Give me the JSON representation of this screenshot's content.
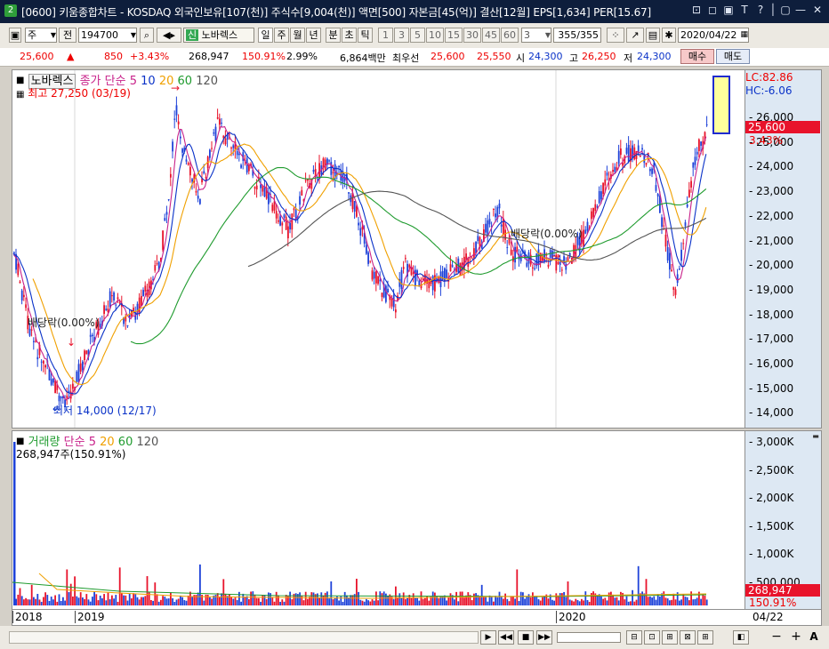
{
  "window": {
    "icon_text": "2",
    "title": "[0600] 키움종합차트 - KOSDAQ 외국인보유[107(천)] 주식수[9,004(천)] 액면[500] 자본금[45(억)] 결산[12월] EPS[1,634] PER[15.67]",
    "controls": [
      "⊡",
      "◻",
      "▣",
      "T",
      "?",
      "│",
      "▢",
      "◫",
      "—",
      "✕"
    ]
  },
  "toolbar": {
    "mode": "주",
    "prev_label": "전",
    "code": "194700",
    "credit_badge": "신",
    "stock_name": "노바렉스",
    "periods": [
      "일",
      "주",
      "월",
      "년",
      "분",
      "초",
      "틱"
    ],
    "selected_period": "일",
    "intervals": [
      "1",
      "3",
      "5",
      "10",
      "15",
      "30",
      "45",
      "60"
    ],
    "interval_value": "3",
    "count": "355/355",
    "date": "2020/04/22"
  },
  "quote": {
    "price": "25,600",
    "change": "850",
    "change_rate": "+3.43%",
    "volume": "268,947",
    "volume_rate": "150.91%",
    "turnover": "2.99%",
    "amount": "6,864백만",
    "ask_label": "최우선",
    "ask": "25,600",
    "bid": "25,550",
    "open_label": "시",
    "open": "24,300",
    "high_label": "고",
    "high": "26,250",
    "low_label": "저",
    "low": "24,300",
    "buy_label": "매수",
    "sell_label": "매도"
  },
  "price_pane": {
    "legend": {
      "name": "노바렉스",
      "price_label": "종가",
      "ma_label": "단순",
      "ma": [
        "5",
        "10",
        "20",
        "60",
        "120"
      ],
      "ma_colors": [
        "#c8228a",
        "#0a32c8",
        "#f0a000",
        "#1f9b2e",
        "#555555"
      ]
    },
    "max_label": "최고 27,250 (03/19)",
    "min_label": "최저 14,000 (12/17)",
    "dividend_label_1": "배당락(0.00%)",
    "dividend_label_2": "배당락(0.00%)",
    "lc": "LC:82.86",
    "hc": "HC:-6.06",
    "current_price": "25,600",
    "current_rate": "3.43%",
    "axis_ticks": [
      "26,000",
      "25,000",
      "24,000",
      "23,000",
      "22,000",
      "21,000",
      "20,000",
      "19,000",
      "18,000",
      "17,000",
      "16,000",
      "15,000",
      "14,000"
    ]
  },
  "volume_pane": {
    "legend": {
      "name": "거래량",
      "ma_label": "단순",
      "ma": [
        "5",
        "20",
        "60",
        "120"
      ]
    },
    "last_label": "268,947주(150.91%)",
    "current_volume": "268,947",
    "current_rate": "150.91%",
    "axis_ticks": [
      "3,000K",
      "2,500K",
      "2,000K",
      "1,500K",
      "1,000K",
      "500,000"
    ]
  },
  "x_axis": {
    "labels": [
      "2018",
      "2019",
      "2020"
    ],
    "right_label": "04/22"
  },
  "bottom_controls": [
    "▶",
    "◀◀",
    "■",
    "▶▶",
    "⊟",
    "⊡",
    "⊞",
    "⊠",
    "⊞",
    "◧",
    "−",
    "+",
    "A"
  ],
  "colors": {
    "up": "#e8132b",
    "down": "#1f43d9",
    "title_bg": "#0e1e3c",
    "axis_bg": "#dde8f3"
  }
}
